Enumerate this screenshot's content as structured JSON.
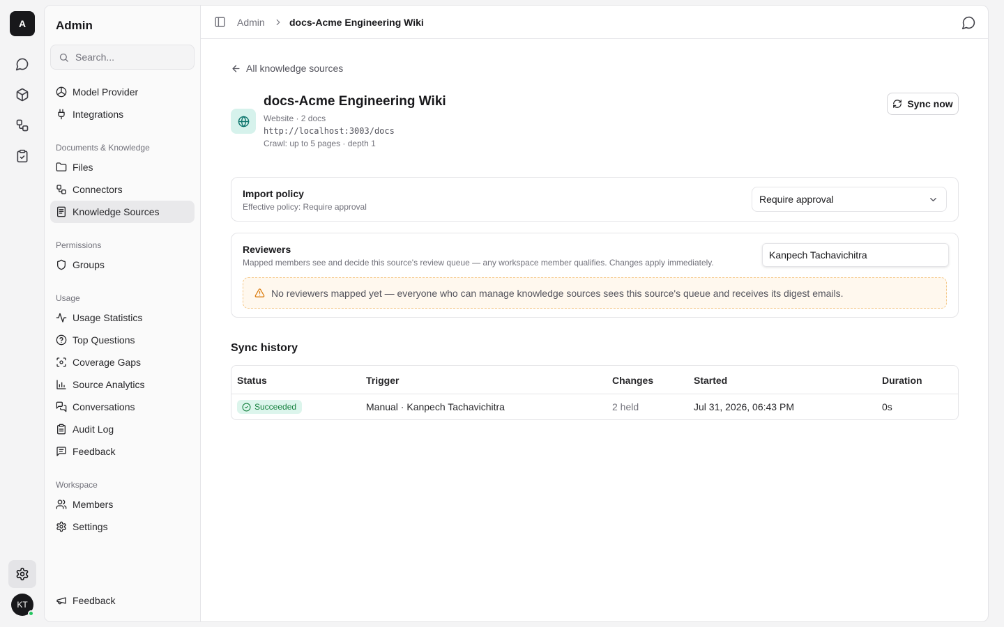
{
  "workspace": {
    "initial": "A"
  },
  "user": {
    "initials": "KT"
  },
  "sidebar": {
    "title": "Admin",
    "search_placeholder": "Search...",
    "top_items": [
      {
        "label": "Model Provider",
        "icon": "model-icon"
      },
      {
        "label": "Integrations",
        "icon": "plug-icon"
      }
    ],
    "sections": [
      {
        "title": "Documents & Knowledge",
        "items": [
          {
            "label": "Files",
            "icon": "folder-icon"
          },
          {
            "label": "Connectors",
            "icon": "connectors-icon"
          },
          {
            "label": "Knowledge Sources",
            "icon": "book-icon",
            "active": true
          }
        ]
      },
      {
        "title": "Permissions",
        "items": [
          {
            "label": "Groups",
            "icon": "shield-icon"
          }
        ]
      },
      {
        "title": "Usage",
        "items": [
          {
            "label": "Usage Statistics",
            "icon": "activity-icon"
          },
          {
            "label": "Top Questions",
            "icon": "question-icon"
          },
          {
            "label": "Coverage Gaps",
            "icon": "scan-icon"
          },
          {
            "label": "Source Analytics",
            "icon": "bar-chart-icon"
          },
          {
            "label": "Conversations",
            "icon": "messages-icon"
          },
          {
            "label": "Audit Log",
            "icon": "clipboard-icon"
          },
          {
            "label": "Feedback",
            "icon": "message-square-icon"
          }
        ]
      },
      {
        "title": "Workspace",
        "items": [
          {
            "label": "Members",
            "icon": "users-icon"
          },
          {
            "label": "Settings",
            "icon": "gear-icon"
          }
        ]
      }
    ],
    "footer_item": {
      "label": "Feedback",
      "icon": "megaphone-icon"
    }
  },
  "breadcrumb": {
    "root": "Admin",
    "current": "docs-Acme Engineering Wiki"
  },
  "source": {
    "back_label": "All knowledge sources",
    "title": "docs-Acme Engineering Wiki",
    "meta": "Website · 2 docs",
    "url": "http://localhost:3003/docs",
    "crawl": "Crawl: up to 5 pages · depth 1",
    "sync_label": "Sync now"
  },
  "import_policy": {
    "title": "Import policy",
    "subtitle": "Effective policy: Require approval",
    "selected": "Require approval"
  },
  "reviewers": {
    "title": "Reviewers",
    "subtitle": "Mapped members see and decide this source's review queue — any workspace member qualifies. Changes apply immediately.",
    "input_value": "Kanpech Tachavichitra",
    "warning": "No reviewers mapped yet — everyone who can manage knowledge sources sees this source's queue and receives its digest emails."
  },
  "sync_history": {
    "title": "Sync history",
    "columns": [
      "Status",
      "Trigger",
      "Changes",
      "Started",
      "Duration"
    ],
    "rows": [
      {
        "status": "Succeeded",
        "trigger": "Manual · Kanpech Tachavichitra",
        "changes": "2 held",
        "started": "Jul 31, 2026, 06:43 PM",
        "duration": "0s"
      }
    ]
  },
  "colors": {
    "accent_teal": "#0f766e",
    "success": "#15803d",
    "warning": "#d97706"
  }
}
